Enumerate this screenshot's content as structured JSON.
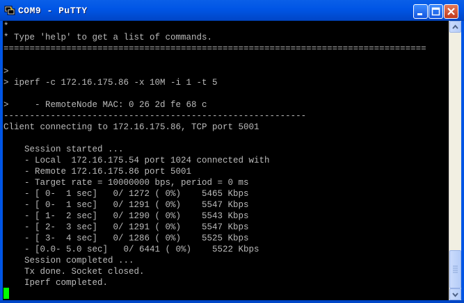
{
  "window": {
    "title": "COM9 - PuTTY"
  },
  "terminal": {
    "lines": [
      "*",
      "* Type 'help' to get a list of commands.",
      "=================================================================================",
      "",
      "",
      ">",
      "> iperf -c 172.16.175.86 -x 10M -i 1 -t 5",
      "",
      ">     - RemoteNode MAC: 0 26 2d fe 68 c",
      "----------------------------------------------------------",
      "Client connecting to 172.16.175.86, TCP port 5001",
      "",
      "    Session started ...",
      "    - Local  172.16.175.54 port 1024 connected with",
      "    - Remote 172.16.175.86 port 5001",
      "    - Target rate = 10000000 bps, period = 0 ms",
      "    - [ 0-  1 sec]   0/ 1272 ( 0%)    5465 Kbps",
      "    - [ 0-  1 sec]   0/ 1291 ( 0%)    5547 Kbps",
      "    - [ 1-  2 sec]   0/ 1290 ( 0%)    5543 Kbps",
      "    - [ 2-  3 sec]   0/ 1291 ( 0%)    5547 Kbps",
      "    - [ 3-  4 sec]   0/ 1286 ( 0%)    5525 Kbps",
      "    - [0.0- 5.0 sec]   0/ 6441 ( 0%)    5522 Kbps",
      "    Session completed ...",
      "    Tx done. Socket closed.",
      "    Iperf completed."
    ]
  },
  "colors": {
    "terminal_bg": "#000000",
    "terminal_fg": "#bbbbbb",
    "cursor": "#00ff00",
    "titlebar": "#0055e5"
  },
  "icons": {
    "app": "putty-icon",
    "minimize": "minimize-icon",
    "maximize": "maximize-icon",
    "close": "close-icon"
  }
}
